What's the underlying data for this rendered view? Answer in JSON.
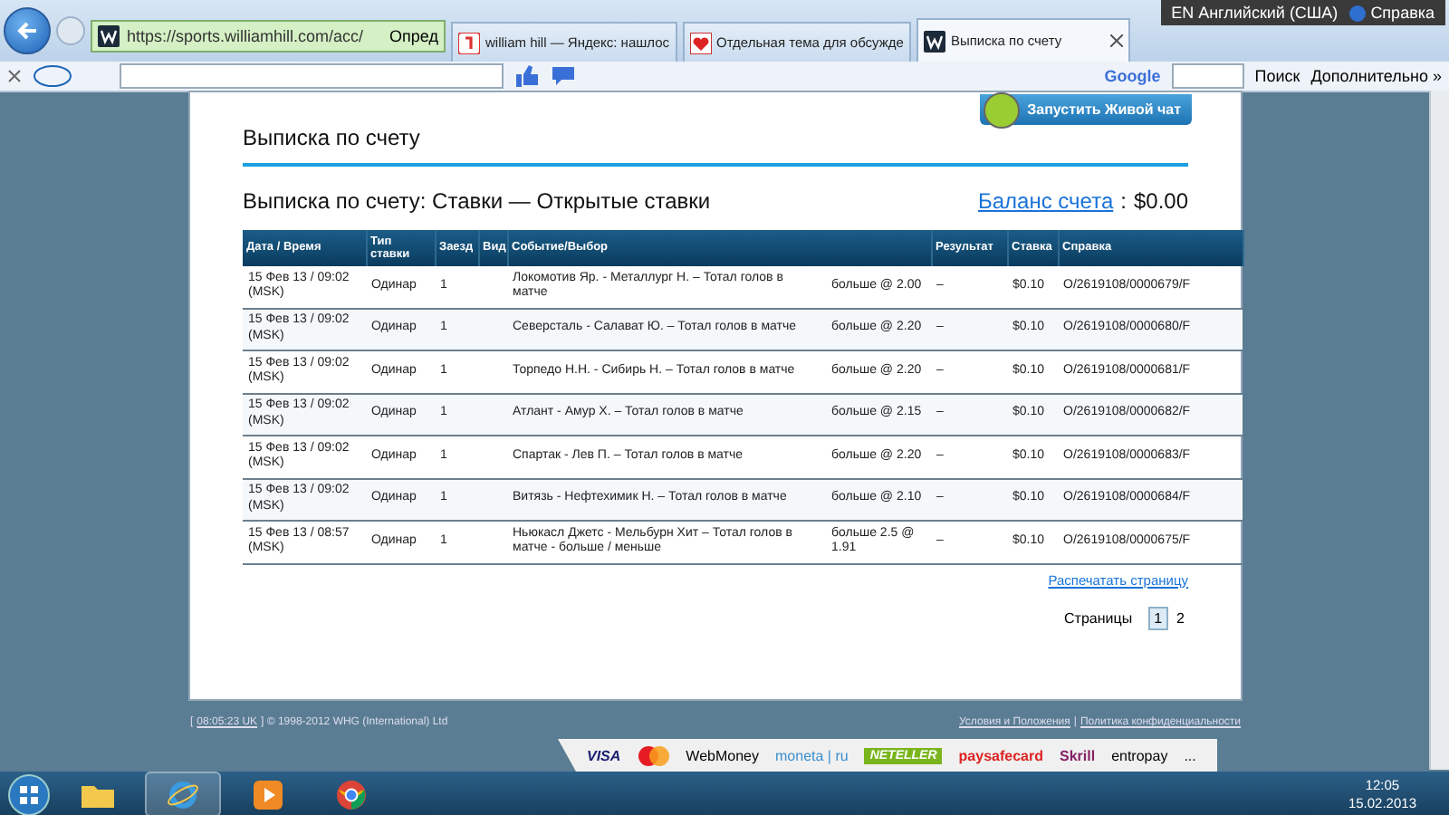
{
  "browser": {
    "address": "https://sports.williamhill.com/acc/",
    "site_info": "Опред",
    "language": "EN Английский (США)",
    "help": "Справка",
    "tabs": [
      {
        "title": "william hill — Яндекс: нашлос",
        "selected": false
      },
      {
        "title": "Отдельная тема для обсужде",
        "selected": false
      },
      {
        "title": "Выписка по счету",
        "selected": true
      }
    ]
  },
  "toolbar": {
    "google": "Google",
    "search_button": "Поиск",
    "more": "Дополнительно »"
  },
  "page": {
    "heading": "Выписка по счету",
    "chat_button": "Запустить Живой чат",
    "subheading": "Выписка по счету: Ставки  —  Открытые ставки",
    "balance_label": "Баланс счета",
    "balance_colon": ":",
    "balance_value": "$0.00",
    "columns": [
      "Дата  /  Время",
      "Тип ставки",
      "Заезд",
      "Вид",
      "Событие/Выбор",
      "Результат",
      "Ставка",
      "Справка"
    ],
    "rows": [
      {
        "date": "15 Фев 13 / 09:02 (MSK)",
        "type": "Одинар",
        "leg": "1",
        "event": "Локомотив Яр. - Металлург Н.  –  Тотал голов в матче",
        "selection": "больше @ 2.00",
        "result": "–",
        "stake": "$0.10",
        "reference": "O/2619108/0000679/F"
      },
      {
        "date": "15 Фев 13 / 09:02 (MSK)",
        "type": "Одинар",
        "leg": "1",
        "event": "Северсталь - Салават Ю.  –  Тотал голов в матче",
        "selection": "больше @ 2.20",
        "result": "–",
        "stake": "$0.10",
        "reference": "O/2619108/0000680/F"
      },
      {
        "date": "15 Фев 13 / 09:02 (MSK)",
        "type": "Одинар",
        "leg": "1",
        "event": "Торпедо Н.Н. - Сибирь Н.  –  Тотал голов в матче",
        "selection": "больше @ 2.20",
        "result": "–",
        "stake": "$0.10",
        "reference": "O/2619108/0000681/F"
      },
      {
        "date": "15 Фев 13 / 09:02 (MSK)",
        "type": "Одинар",
        "leg": "1",
        "event": "Атлант - Амур Х.  –  Тотал голов в матче",
        "selection": "больше @ 2.15",
        "result": "–",
        "stake": "$0.10",
        "reference": "O/2619108/0000682/F"
      },
      {
        "date": "15 Фев 13 / 09:02 (MSK)",
        "type": "Одинар",
        "leg": "1",
        "event": "Спартак - Лев П.  –  Тотал голов в матче",
        "selection": "больше @ 2.20",
        "result": "–",
        "stake": "$0.10",
        "reference": "O/2619108/0000683/F"
      },
      {
        "date": "15 Фев 13 / 09:02 (MSK)",
        "type": "Одинар",
        "leg": "1",
        "event": "Витязь - Нефтехимик Н.  –  Тотал голов в матче",
        "selection": "больше @ 2.10",
        "result": "–",
        "stake": "$0.10",
        "reference": "O/2619108/0000684/F"
      },
      {
        "date": "15 Фев 13 / 08:57 (MSK)",
        "type": "Одинар",
        "leg": "1",
        "event": "Ньюкасл Джетс - Мельбурн Хит  –  Тотал голов в матче - больше / меньше",
        "selection": "больше 2.5 @ 1.91",
        "result": "–",
        "stake": "$0.10",
        "reference": "O/2619108/0000675/F"
      }
    ],
    "print_link": "Распечатать страницу",
    "pages_label": "Страницы",
    "pages": [
      {
        "label": "1",
        "selected": true
      },
      {
        "label": "2",
        "selected": false
      }
    ]
  },
  "footer": {
    "open_bracket": "[",
    "time": "08:05:23 UK",
    "copyright": "] © 1998-2012 WHG (International) Ltd",
    "links": [
      "Условия и Положения",
      "Политика конфиденциальности"
    ],
    "separator": "|"
  },
  "payments": [
    {
      "kind": "visa",
      "label": "VISA"
    },
    {
      "kind": "mastercard"
    },
    {
      "kind": "webmoney",
      "label": "WebMoney"
    },
    {
      "kind": "moneta",
      "label": "moneta | ru"
    },
    {
      "kind": "neteller",
      "label": "NETELLER"
    },
    {
      "kind": "paysafe",
      "label": "paysafecard"
    },
    {
      "kind": "skrill",
      "label": "Skrill"
    },
    {
      "kind": "entropay",
      "label": "entropay"
    },
    {
      "kind": "more",
      "label": "..."
    }
  ],
  "taskbar": {
    "time": "12:05",
    "date": "15.02.2013"
  }
}
